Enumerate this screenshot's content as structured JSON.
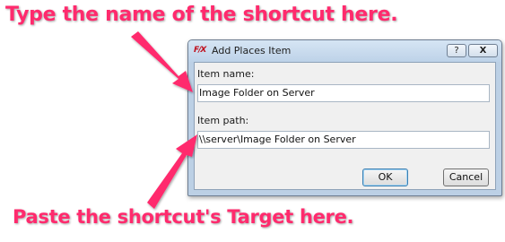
{
  "annotations": {
    "top": "Type the name of the shortcut here.",
    "bottom": "Paste the shortcut's Target here."
  },
  "colors": {
    "annotation": "#ff2a6d",
    "dialog_frame": "#bcd0e5",
    "client_bg": "#f0f0f0"
  },
  "dialog": {
    "app_icon_text": "F/X",
    "title": "Add Places Item",
    "help_button_label": "?",
    "close_button_label": "X",
    "item_name_label": "Item name:",
    "item_name_value": "Image Folder on Server",
    "item_path_label": "Item path:",
    "item_path_value": "\\\\server\\Image Folder on Server",
    "ok_label": "OK",
    "cancel_label": "Cancel"
  }
}
